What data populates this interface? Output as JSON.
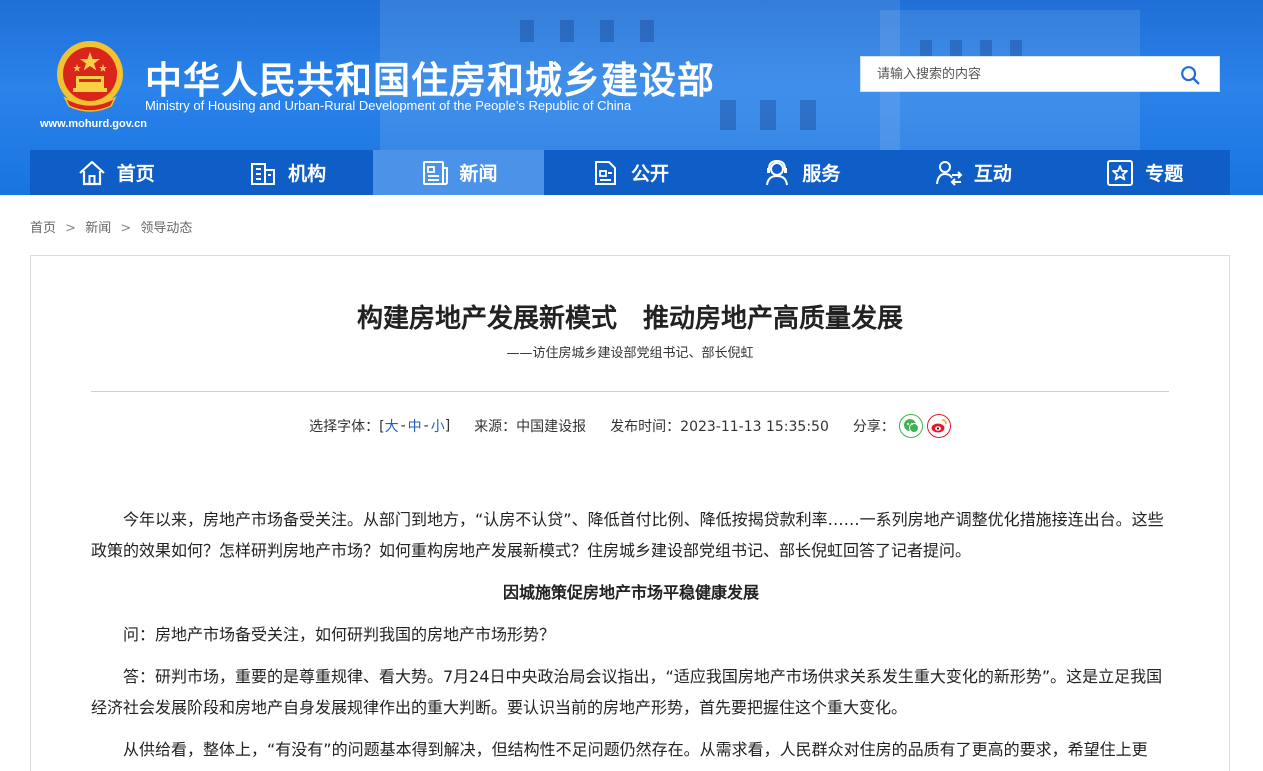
{
  "header": {
    "title": "中华人民共和国住房和城乡建设部",
    "subtitle": "Ministry of Housing and Urban-Rural Development of the People’s Republic of China",
    "url": "www.mohurd.gov.cn",
    "emblem_icon": "national-emblem-icon",
    "search": {
      "placeholder": "请输入搜索的内容",
      "icon": "search-icon"
    }
  },
  "nav": {
    "active": "新闻",
    "items": [
      {
        "label": "首页",
        "icon": "home-icon"
      },
      {
        "label": "机构",
        "icon": "building-icon"
      },
      {
        "label": "新闻",
        "icon": "newspaper-icon"
      },
      {
        "label": "公开",
        "icon": "document-icon"
      },
      {
        "label": "服务",
        "icon": "service-icon"
      },
      {
        "label": "互动",
        "icon": "interaction-icon"
      },
      {
        "label": "专题",
        "icon": "star-icon"
      }
    ]
  },
  "breadcrumb": {
    "items": [
      "首页",
      "新闻",
      "领导动态"
    ],
    "separator": ">"
  },
  "article": {
    "title": "构建房地产发展新模式　推动房地产高质量发展",
    "subtitle": "——访住房城乡建设部党组书记、部长倪虹",
    "meta": {
      "font_label": "选择字体：[",
      "font_large": "大",
      "font_medium": "中",
      "font_small": "小",
      "font_close": "]",
      "dash": "-",
      "source": "来源：中国建设报",
      "published": "发布时间：2023-11-13 15:35:50",
      "share_label": "分享："
    },
    "paragraphs": [
      "今年以来，房地产市场备受关注。从部门到地方，“认房不认贷”、降低首付比例、降低按揭贷款利率……一系列房地产调整优化措施接连出台。这些政策的效果如何？怎样研判房地产市场？如何重构房地产发展新模式？住房城乡建设部党组书记、部长倪虹回答了记者提问。",
      "因城施策促房地产市场平稳健康发展",
      "问：房地产市场备受关注，如何研判我国的房地产市场形势？",
      "答：研判市场，重要的是尊重规律、看大势。7月24日中央政治局会议指出，“适应我国房地产市场供求关系发生重大变化的新形势”。这是立足我国经济社会发展阶段和房地产自身发展规律作出的重大判断。要认识当前的房地产形势，首先要把握住这个重大变化。",
      "从供给看，整体上，“有没有”的问题基本得到解决，但结构性不足问题仍然存在。从需求看，人民群众对住房的品质有了更高的要求，希望住上更"
    ]
  },
  "colors": {
    "header_blue": "#1f6fd6",
    "nav_blue": "#0f5ec7",
    "nav_active": "#4a93e8",
    "link_blue": "#1d5fbf",
    "wechat_green": "#3fb34f",
    "weibo_red": "#e6162d"
  }
}
